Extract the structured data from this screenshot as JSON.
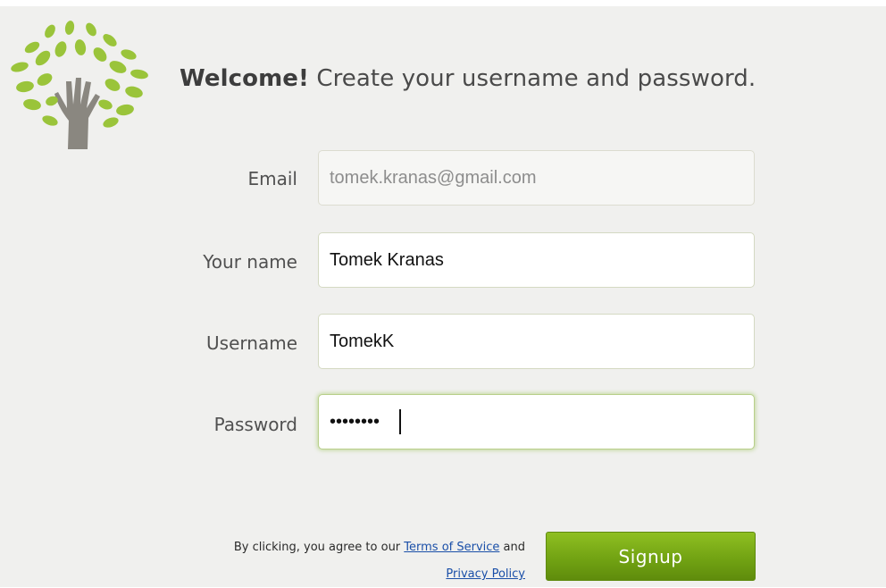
{
  "header": {
    "welcome_bold": "Welcome!",
    "welcome_rest": " Create your username and password."
  },
  "form": {
    "email": {
      "label": "Email",
      "value": "tomek.kranas@gmail.com"
    },
    "name": {
      "label": "Your name",
      "value": "Tomek Kranas"
    },
    "username": {
      "label": "Username",
      "value": "TomekK"
    },
    "password": {
      "label": "Password",
      "value": "••••••••"
    }
  },
  "footer": {
    "agree_prefix": "By clicking, you agree to our ",
    "terms_label": "Terms of Service",
    "and_text": " and ",
    "privacy_label": "Privacy Policy",
    "signup_label": "Signup"
  },
  "colors": {
    "background": "#f0f0ee",
    "leaf_green": "#9ac43a",
    "hand_gray": "#8a8780",
    "button_green": "#72a313",
    "link_blue": "#1a4fa8"
  },
  "icons": {
    "logo": "tree-hand-logo-icon"
  }
}
